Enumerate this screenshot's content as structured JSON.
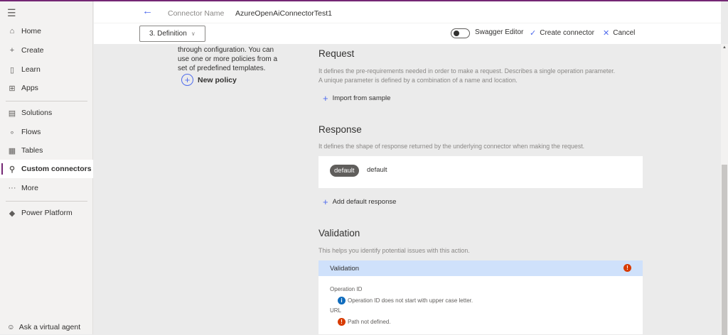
{
  "sidebar": {
    "items": [
      {
        "label": "Home",
        "icon": "home-icon",
        "glyph": "⌂"
      },
      {
        "label": "Create",
        "icon": "plus-icon",
        "glyph": "+"
      },
      {
        "label": "Learn",
        "icon": "book-icon",
        "glyph": "▯"
      },
      {
        "label": "Apps",
        "icon": "apps-icon",
        "glyph": "⊞"
      },
      {
        "label": "Solutions",
        "icon": "solutions-icon",
        "glyph": "▤"
      },
      {
        "label": "Flows",
        "icon": "flows-icon",
        "glyph": "∘"
      },
      {
        "label": "Tables",
        "icon": "table-icon",
        "glyph": "▦"
      },
      {
        "label": "Custom connectors",
        "icon": "connector-icon",
        "glyph": "⚲"
      },
      {
        "label": "More",
        "icon": "more-icon",
        "glyph": "···"
      },
      {
        "label": "Power Platform",
        "icon": "power-platform-icon",
        "glyph": "◆"
      }
    ],
    "bottom": {
      "label": "Ask a virtual agent",
      "glyph": "☺"
    }
  },
  "header": {
    "connector_name_label": "Connector Name",
    "connector_name": "AzureOpenAiConnectorTest1",
    "step": "3. Definition",
    "swagger": "Swagger Editor",
    "create": "Create connector",
    "cancel": "Cancel",
    "swagger_on": false
  },
  "policies": {
    "desc_lines": [
      "through configuration. You can",
      "use one or more policies from a",
      "set of predefined templates."
    ],
    "new_policy": "New policy"
  },
  "request": {
    "title": "Request",
    "desc1": "It defines the pre-requirements needed in order to make a request. Describes a single operation parameter.",
    "desc2": "A unique parameter is defined by a combination of a name and location.",
    "import": "Import from sample"
  },
  "response": {
    "title": "Response",
    "desc": "It defines the shape of response returned by the underlying connector when making the request.",
    "pill": "default",
    "pill_text": "default",
    "add": "Add default response"
  },
  "validation": {
    "title": "Validation",
    "desc": "This helps you identify potential issues with this action.",
    "header": "Validation",
    "op_label": "Operation ID",
    "op_msg": "Operation ID does not start with upper case letter.",
    "url_label": "URL",
    "url_msg": "Path not defined."
  },
  "colors": {
    "accent": "#742774",
    "link": "#4f6bed",
    "error": "#d83b01",
    "info": "#0f6cbd"
  }
}
